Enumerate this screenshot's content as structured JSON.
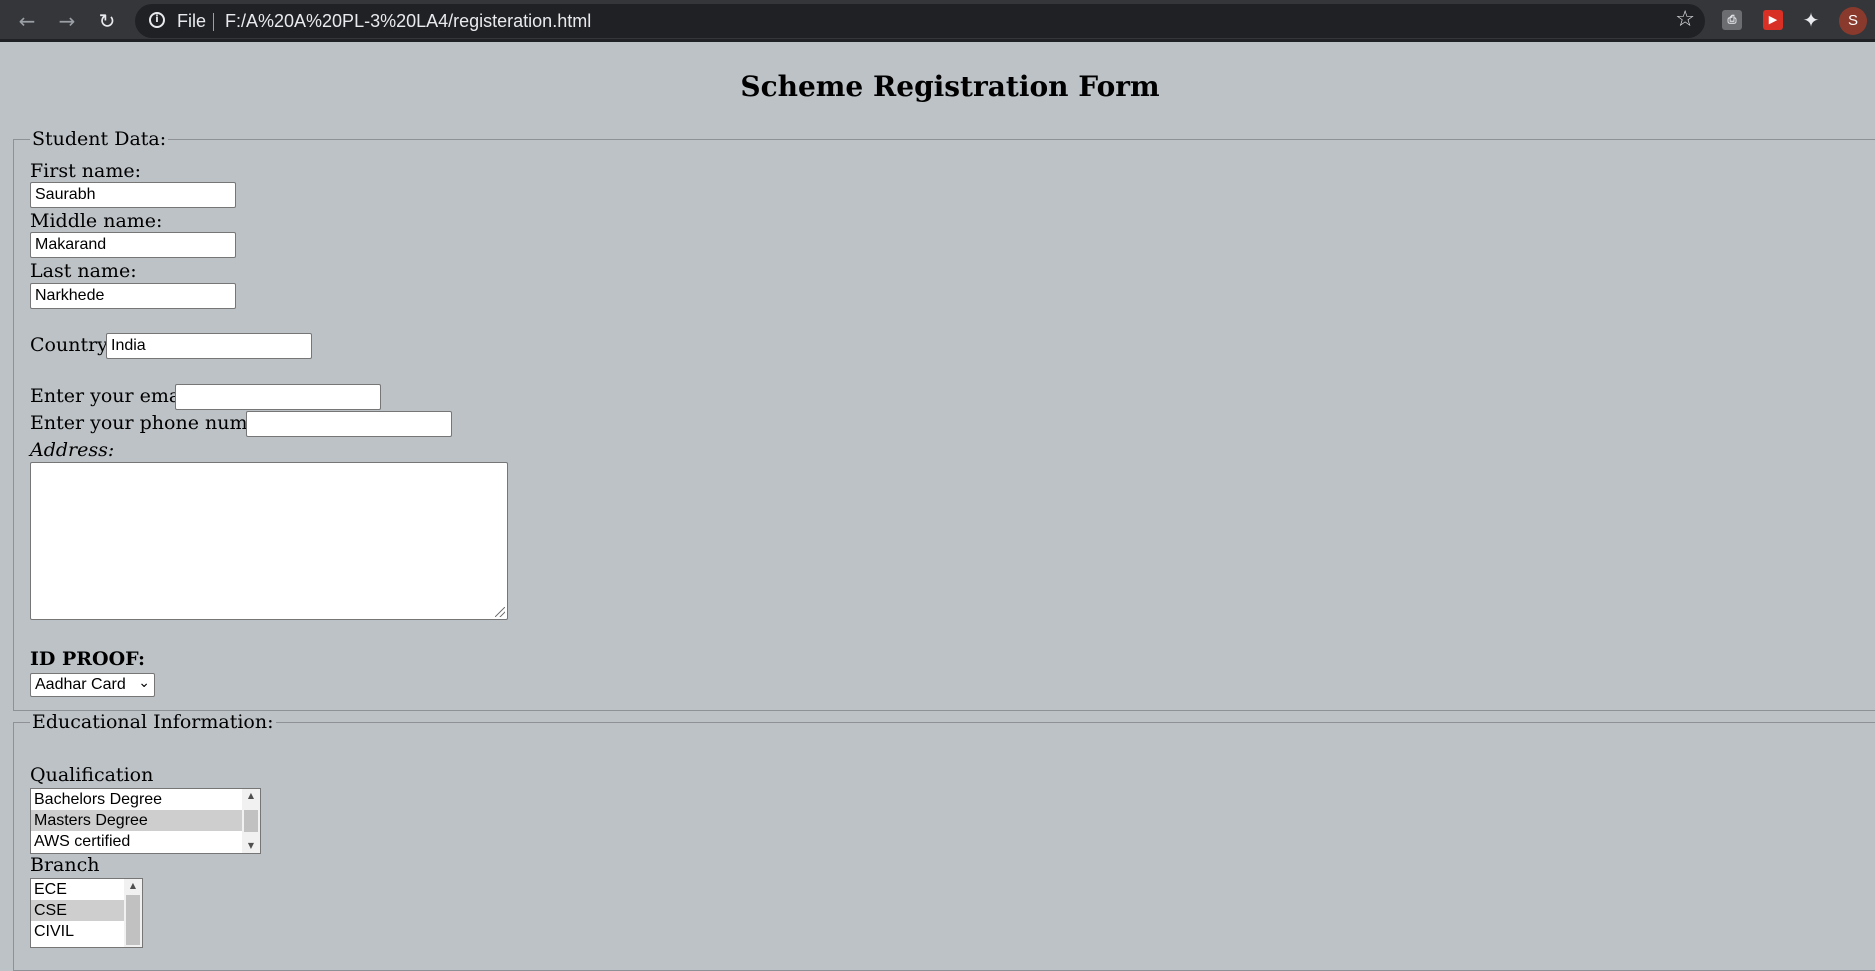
{
  "browser": {
    "back_icon": "←",
    "forward_icon": "→",
    "reload_icon": "↻",
    "info_icon": "i",
    "scheme": "File",
    "url": "F:/A%20A%20PL-3%20LA4/registeration.html",
    "star_icon": "☆",
    "extensions": {
      "pdf": "⎙",
      "red": "▶",
      "puzzle": "✦"
    },
    "avatar_initial": "S"
  },
  "page": {
    "title": "Scheme Registration Form"
  },
  "student": {
    "legend": "Student Data:",
    "first_name_label": "First name:",
    "first_name_value": "Saurabh",
    "middle_name_label": "Middle name:",
    "middle_name_value": "Makarand",
    "last_name_label": "Last name:",
    "last_name_value": "Narkhede",
    "country_label": "Country:",
    "country_value": "India",
    "email_label": "Enter your email:",
    "email_value": "",
    "phone_label": "Enter your phone number:",
    "phone_value": "",
    "address_label": "Address:",
    "id_proof_label": "ID PROOF:",
    "id_proof_selected": "Aadhar Card",
    "dropdown_icon": "⌄"
  },
  "education": {
    "legend": "Educational Information:",
    "qualification_label": "Qualification",
    "qualification_options": [
      "Bachelors Degree",
      "Masters Degree",
      "AWS certified"
    ],
    "qualification_selected_index": 1,
    "branch_label": "Branch",
    "branch_options": [
      "ECE",
      "CSE",
      "CIVIL"
    ],
    "branch_selected_index": 1,
    "scroll_up_icon": "▲",
    "scroll_down_icon": "▼"
  }
}
